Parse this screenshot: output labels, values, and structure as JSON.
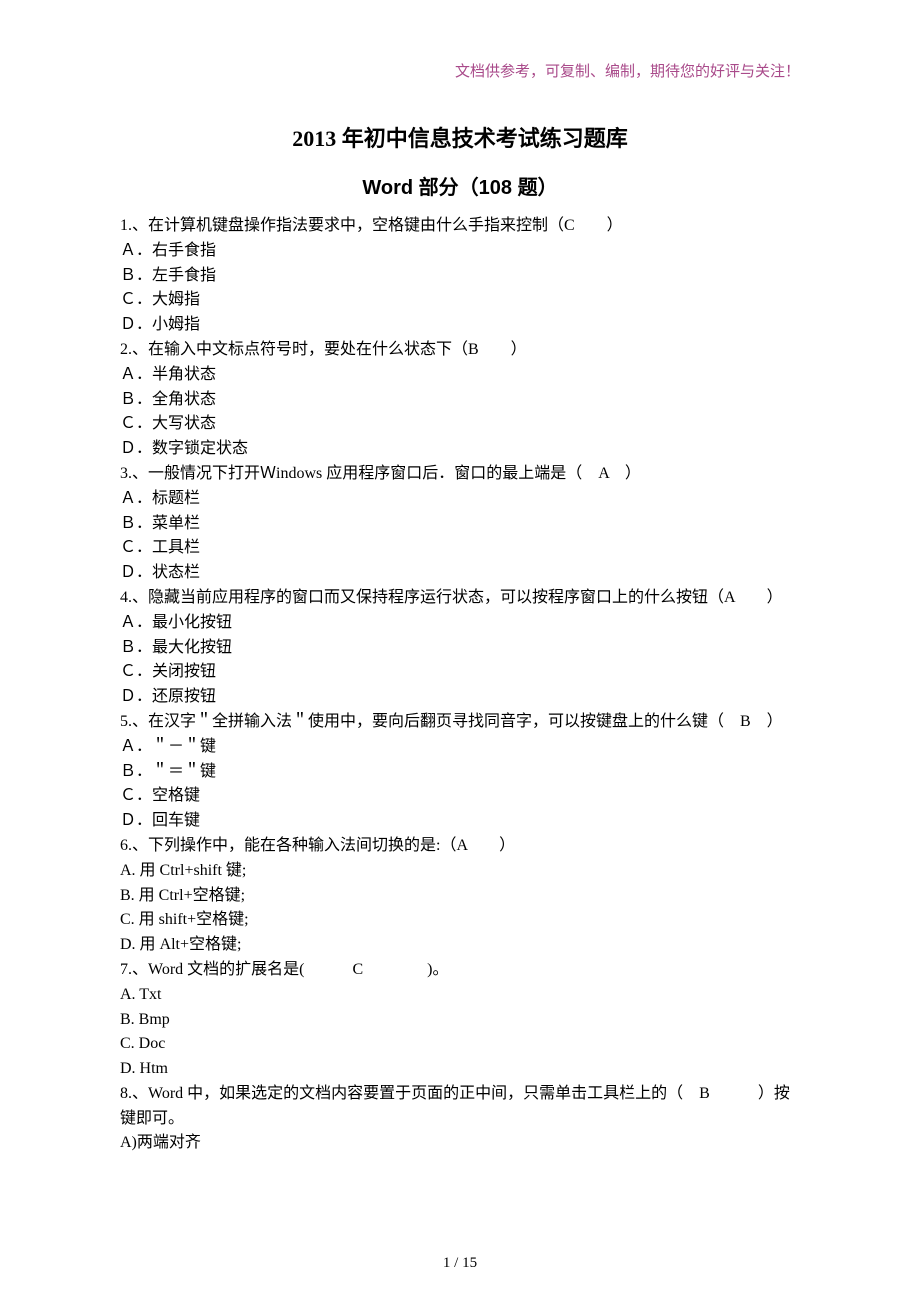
{
  "header_note": "文档供参考，可复制、编制，期待您的好评与关注！",
  "title": "2013 年初中信息技术考试练习题库",
  "subtitle": "Word 部分（108 题）",
  "lines": [
    "1.、在计算机键盘操作指法要求中，空格键由什么手指来控制（C　　）",
    "Ａ．右手食指",
    "Ｂ．左手食指",
    "Ｃ．大姆指",
    "Ｄ．小姆指",
    "2.、在输入中文标点符号时，要处在什么状态下（B　　）",
    "Ａ．半角状态",
    "Ｂ．全角状态",
    "Ｃ．大写状态",
    "Ｄ．数字锁定状态",
    "3.、一般情况下打开Ｗindows 应用程序窗口后．窗口的最上端是（　A　）",
    "Ａ．标题栏",
    "Ｂ．菜单栏",
    "Ｃ．工具栏",
    "Ｄ．状态栏",
    "4.、隐藏当前应用程序的窗口而又保持程序运行状态，可以按程序窗口上的什么按钮（A　　）",
    "Ａ．最小化按钮",
    "Ｂ．最大化按钮",
    "Ｃ．关闭按钮",
    "Ｄ．还原按钮",
    "5.、在汉字＂全拼输入法＂使用中，要向后翻页寻找同音字，可以按键盘上的什么键（　B　）",
    "Ａ．＂－＂键",
    "Ｂ．＂＝＂键",
    "Ｃ．空格键",
    "Ｄ．回车键",
    "6.、下列操作中，能在各种输入法间切换的是:（A　　）",
    "A. 用 Ctrl+shift 键;",
    "B. 用 Ctrl+空格键;",
    "C. 用 shift+空格键;",
    "D. 用 Alt+空格键;",
    "7.、Word 文档的扩展名是(　　　C　　　　)。",
    "A. Txt",
    "B. Bmp",
    "C. Doc",
    "D. Htm",
    "8.、Word 中，如果选定的文档内容要置于页面的正中间，只需单击工具栏上的（　B　　　）按键即可。",
    "A)两端对齐"
  ],
  "page_number": "1 / 15"
}
